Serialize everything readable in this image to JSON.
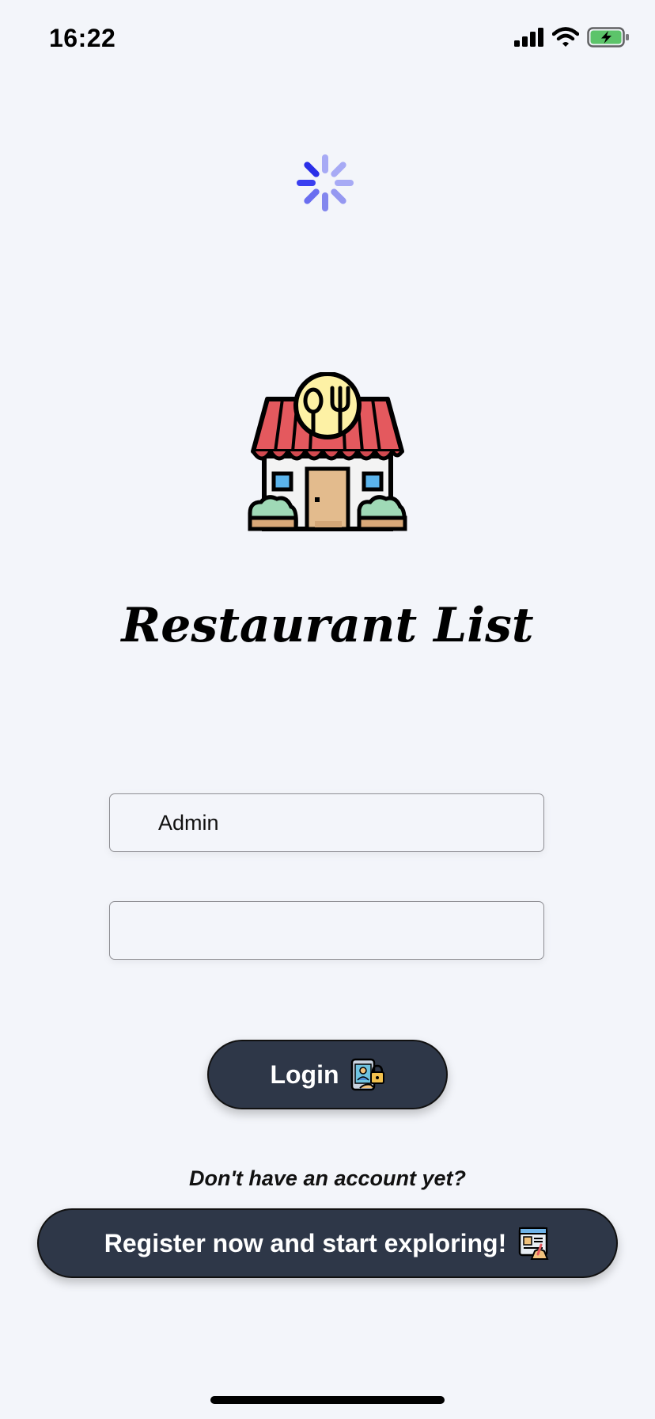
{
  "status_bar": {
    "time": "16:22",
    "icons": [
      "signal-icon",
      "wifi-icon",
      "battery-charging-icon"
    ],
    "battery_color": "#5cc46a"
  },
  "spinner": {
    "icon": "loading-spinner-icon",
    "color": "#3a3ff0"
  },
  "logo": {
    "icon": "restaurant-storefront-icon"
  },
  "app": {
    "title": "Restaurant List"
  },
  "form": {
    "username": {
      "value": "Admin",
      "placeholder": ""
    },
    "password": {
      "value": "",
      "placeholder": ""
    },
    "login_label": "Login",
    "login_icon": "phone-lock-login-icon"
  },
  "register": {
    "prompt": "Don't have an account yet?",
    "button_label": "Register now and start exploring!",
    "button_icon": "registration-form-icon"
  },
  "colors": {
    "background": "#f3f5fa",
    "button_background": "#2e3748",
    "awning_red": "#e4595e",
    "sign_yellow": "#fdf1a5",
    "door_tan": "#e3bb8d",
    "window_blue": "#5bb4ec",
    "bush_green": "#9fd9b6"
  }
}
